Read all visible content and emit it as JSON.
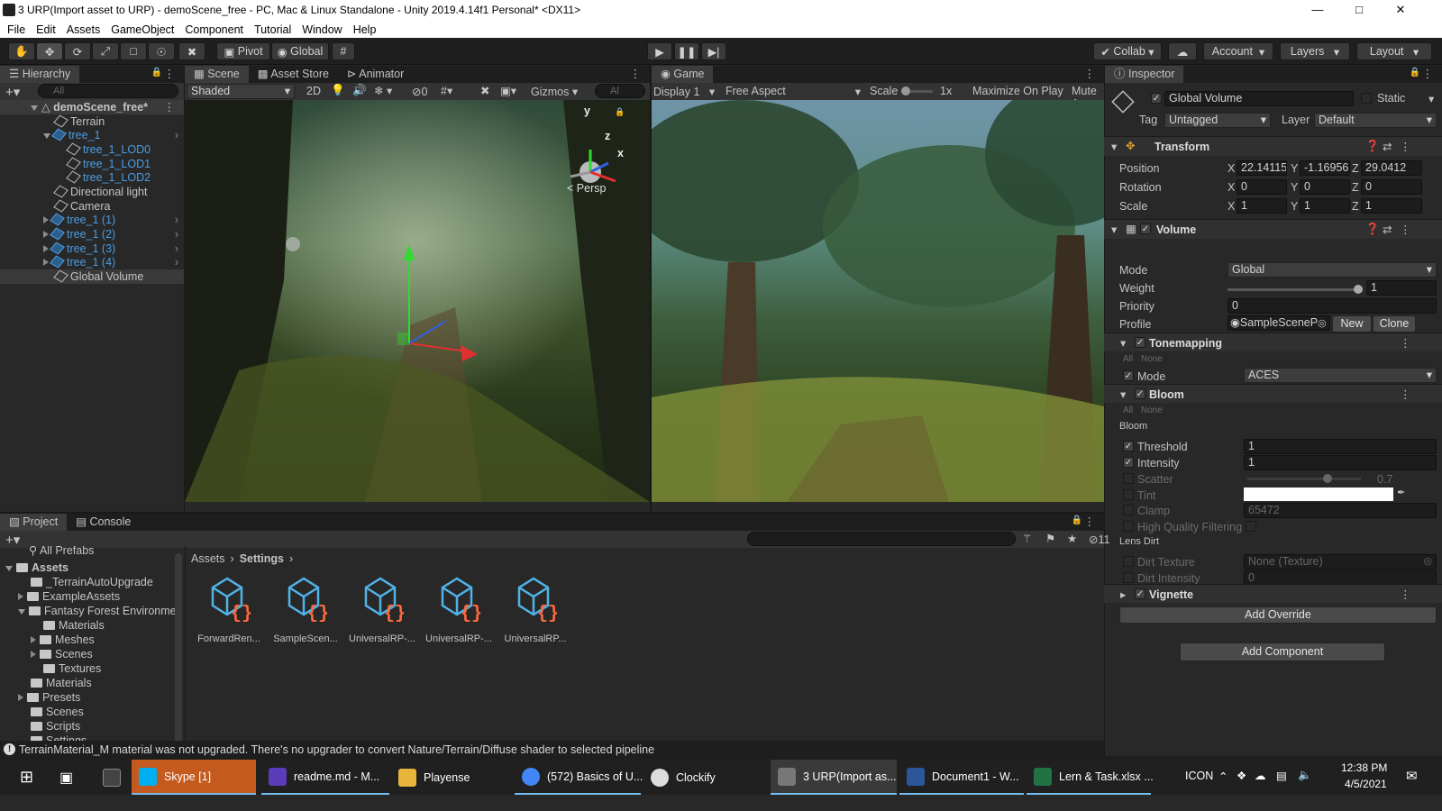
{
  "window": {
    "title": "3 URP(Import asset to URP) - demoScene_free - PC, Mac & Linux Standalone - Unity 2019.4.14f1 Personal* <DX11>"
  },
  "menu": [
    "File",
    "Edit",
    "Assets",
    "GameObject",
    "Component",
    "Tutorial",
    "Window",
    "Help"
  ],
  "toolbar": {
    "pivot": "Pivot",
    "global": "Global",
    "collab": "Collab",
    "account": "Account",
    "layers": "Layers",
    "layout": "Layout"
  },
  "hierarchy": {
    "tab": "Hierarchy",
    "search_placeholder": "All",
    "scene": "demoScene_free*",
    "items": [
      "Terrain",
      "tree_1",
      "tree_1_LOD0",
      "tree_1_LOD1",
      "tree_1_LOD2",
      "Directional light",
      "Camera",
      "tree_1 (1)",
      "tree_1 (2)",
      "tree_1 (3)",
      "tree_1 (4)",
      "Global Volume"
    ]
  },
  "scene_view": {
    "tabs": [
      "Scene",
      "Asset Store",
      "Animator"
    ],
    "shading": "Shaded",
    "mode2d": "2D",
    "hidden_count": "0",
    "gizmos": "Gizmos",
    "search": "Al",
    "persp": "Persp",
    "axis_y": "y",
    "axis_z": "z",
    "axis_x": "x"
  },
  "game_view": {
    "tab": "Game",
    "display": "Display 1",
    "aspect": "Free Aspect",
    "scale_label": "Scale",
    "scale_value": "1x",
    "maximize": "Maximize On Play",
    "mute": "Mute Au"
  },
  "inspector": {
    "tab": "Inspector",
    "object_name": "Global Volume",
    "static": "Static",
    "tag_label": "Tag",
    "tag": "Untagged",
    "layer_label": "Layer",
    "layer": "Default",
    "transform": {
      "title": "Transform",
      "position_label": "Position",
      "rotation_label": "Rotation",
      "scale_label": "Scale",
      "position": [
        "22.14115",
        "-1.16956",
        "29.0412"
      ],
      "rotation": [
        "0",
        "0",
        "0"
      ],
      "scale": [
        "1",
        "1",
        "1"
      ],
      "axes": [
        "X",
        "Y",
        "Z"
      ]
    },
    "volume": {
      "title": "Volume",
      "mode_label": "Mode",
      "mode": "Global",
      "weight_label": "Weight",
      "weight": "1",
      "weight_fill": 1.0,
      "priority_label": "Priority",
      "priority": "0",
      "profile_label": "Profile",
      "profile": "SampleSceneP",
      "new": "New",
      "clone": "Clone"
    },
    "tonemapping": {
      "title": "Tonemapping",
      "all": "All",
      "none": "None",
      "mode_label": "Mode",
      "mode": "ACES"
    },
    "bloom": {
      "title": "Bloom",
      "all": "All",
      "none": "None",
      "group": "Bloom",
      "threshold_label": "Threshold",
      "threshold": "1",
      "intensity_label": "Intensity",
      "intensity": "1",
      "scatter_label": "Scatter",
      "scatter": "0.7",
      "scatter_fill": 0.7,
      "tint_label": "Tint",
      "clamp_label": "Clamp",
      "clamp": "65472",
      "hq_label": "High Quality Filtering",
      "lens_dirt": "Lens Dirt",
      "dirt_texture_label": "Dirt Texture",
      "dirt_texture": "None (Texture)",
      "dirt_intensity_label": "Dirt Intensity",
      "dirt_intensity": "0"
    },
    "vignette": {
      "title": "Vignette"
    },
    "add_override": "Add Override",
    "add_component": "Add Component"
  },
  "project": {
    "tabs": [
      "Project",
      "Console"
    ],
    "all_prefabs": "All Prefabs",
    "tree": [
      "Assets",
      "_TerrainAutoUpgrade",
      "ExampleAssets",
      "Fantasy Forest Environme",
      "Materials",
      "Meshes",
      "Scenes",
      "Textures",
      "Materials",
      "Presets",
      "Scenes",
      "Scripts",
      "Settings"
    ],
    "breadcrumb": [
      "Assets",
      "Settings"
    ],
    "hidden_count": "11",
    "assets": [
      "ForwardRen...",
      "SampleScen...",
      "UniversalRP-...",
      "UniversalRP-...",
      "UniversalRP..."
    ]
  },
  "status": {
    "message": "TerrainMaterial_M material was not upgraded. There's no upgrader to convert Nature/Terrain/Diffuse shader to selected pipeline"
  },
  "taskbar": {
    "items": [
      "Skype [1]",
      "readme.md - M...",
      "Playense",
      "(572) Basics of U...",
      "Clockify",
      "3 URP(Import as...",
      "Document1 - W...",
      "Lern & Task.xlsx ..."
    ],
    "icon_label": "ICON",
    "time": "12:38 PM",
    "date": "4/5/2021"
  },
  "colors": {
    "accent": "#4c9ce3",
    "panel": "#282828",
    "asset_icon": "#4fb3e8",
    "asset_brace": "#ff6a3d"
  }
}
